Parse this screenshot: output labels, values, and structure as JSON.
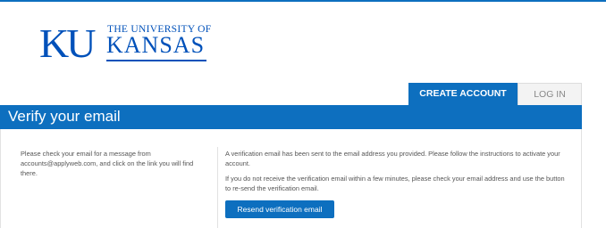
{
  "logo": {
    "monogram": "KU",
    "line1": "THE UNIVERSITY OF",
    "line2": "KANSAS"
  },
  "tabs": [
    {
      "label": "CREATE ACCOUNT",
      "active": true
    },
    {
      "label": "LOG IN",
      "active": false
    }
  ],
  "header": {
    "title": "Verify your email"
  },
  "left": {
    "text": "Please check your email for a message from accounts@applyweb.com, and click on the link you will find there."
  },
  "right": {
    "paragraph1": "A verification email has been sent to the email address you provided. Please follow the instructions to activate your account.",
    "paragraph2": "If you do not receive the verification email within a few minutes, please check your email address and use the button to re-send the verification email.",
    "resend_label": "Resend verification email"
  },
  "colors": {
    "brand_blue": "#0d6fbf",
    "logo_blue": "#0051ba",
    "body_text": "#555555"
  }
}
